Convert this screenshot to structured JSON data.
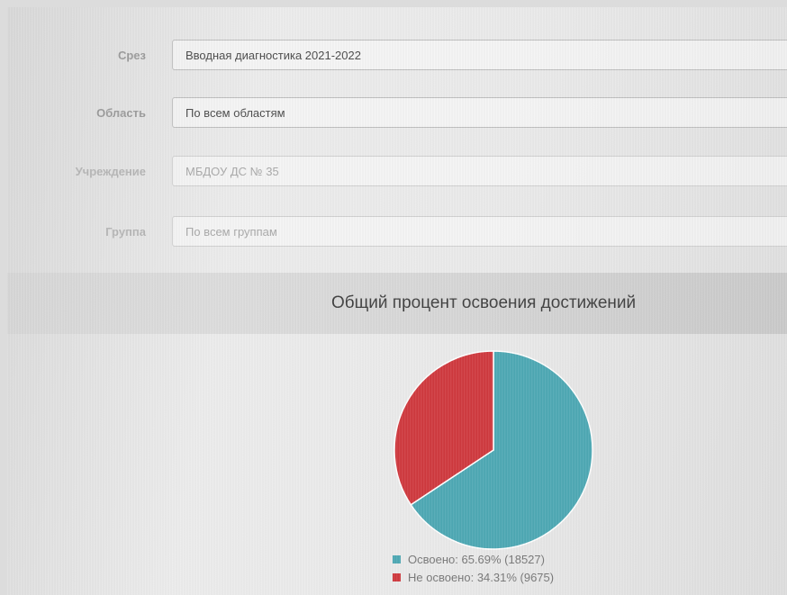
{
  "filters": {
    "slice": {
      "label": "Срез",
      "value": "Вводная диагностика 2021-2022"
    },
    "region": {
      "label": "Область",
      "value": "По всем областям"
    },
    "institution": {
      "label": "Учреждение",
      "value": "МБДОУ ДС № 35"
    },
    "group": {
      "label": "Группа",
      "value": "По всем группам"
    }
  },
  "chart_data": {
    "type": "pie",
    "title": "Общий процент освоения достижений",
    "slices": [
      {
        "label": "Освоено",
        "percent": 65.69,
        "count": 18527,
        "color": "#4da8b4",
        "legend_text": "Освоено: 65.69% (18527)"
      },
      {
        "label": "Не освоено",
        "percent": 34.31,
        "count": 9675,
        "color": "#d0393e",
        "legend_text": "Не освоено: 34.31% (9675)"
      }
    ]
  }
}
